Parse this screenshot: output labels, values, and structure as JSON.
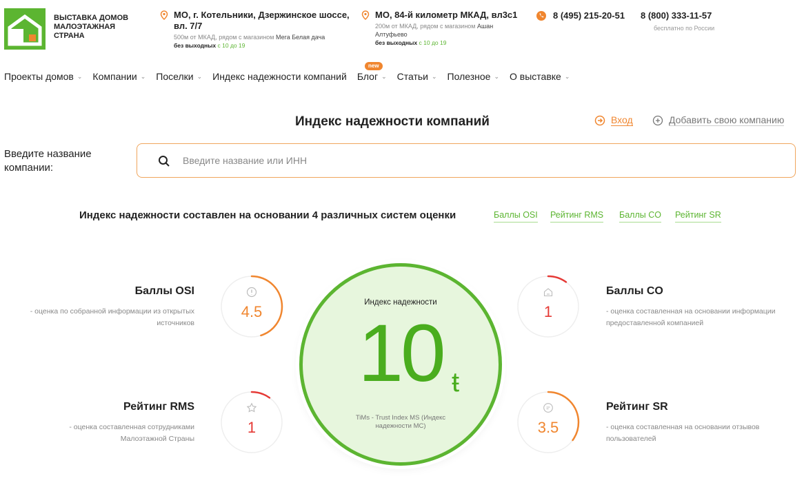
{
  "header": {
    "logo_text": "ВЫСТАВКА ДОМОВ МАЛОЭТАЖНАЯ СТРАНА",
    "locations": [
      {
        "address": "МО, г. Котельники, Дзержинское шоссе, вл. 7/7",
        "sub_prefix": "500м от МКАД, рядом с магазином",
        "sub_store": "Мега Белая дача",
        "hours_prefix": "без выходных",
        "hours": "с 10 до 19"
      },
      {
        "address": "МО, 84-й километр МКАД, вл3с1",
        "sub_prefix": "200м от МКАД, рядом с магазином",
        "sub_store": "Ашан Алтуфьево",
        "hours_prefix": "без выходных",
        "hours": "с 10 до 19"
      }
    ],
    "phone_main": "8 (495) 215-20-51",
    "phone_free": "8 (800) 333-11-57",
    "phone_free_note": "бесплатно по России"
  },
  "nav": {
    "items": [
      {
        "label": "Проекты домов",
        "dropdown": true
      },
      {
        "label": "Компании",
        "dropdown": true
      },
      {
        "label": "Поселки",
        "dropdown": true
      },
      {
        "label": "Индекс надежности компаний",
        "dropdown": false
      },
      {
        "label": "Блог",
        "dropdown": true
      },
      {
        "label": "Статьи",
        "dropdown": true
      },
      {
        "label": "Полезное",
        "dropdown": true
      },
      {
        "label": "О выставке",
        "dropdown": true
      }
    ],
    "badge": "new"
  },
  "page": {
    "title": "Индекс надежности компаний",
    "login": "Вход",
    "add_company": "Добавить свою компанию"
  },
  "search": {
    "label": "Введите название компании:",
    "placeholder": "Введите название или ИНН",
    "value": ""
  },
  "info": {
    "text": "Индекс надежности составлен на основании 4 различных систем оценки",
    "links": [
      "Баллы OSI",
      "Рейтинг RMS",
      "Баллы CO",
      "Рейтинг SR"
    ]
  },
  "index": {
    "label": "Индекс надежности",
    "value": "10",
    "unit": "ŧ",
    "description": "TiMs - Trust Index MS (Индекс надежности МС)"
  },
  "scores": {
    "osi": {
      "title": "Баллы OSI",
      "value": "4.5",
      "desc": "- оценка по собранной информации из открытых источников",
      "color": "#f0862f",
      "fraction": 0.45,
      "icon": "info-icon"
    },
    "rms": {
      "title": "Рейтинг RMS",
      "value": "1",
      "desc": "- оценка составленная сотрудниками Малоэтажной Страны",
      "color": "#e53935",
      "fraction": 0.1,
      "icon": "star-icon"
    },
    "co": {
      "title": "Баллы CO",
      "value": "1",
      "desc": "- оценка составленная на основании информации предоставленной компанией",
      "color": "#e53935",
      "fraction": 0.1,
      "icon": "house-icon"
    },
    "sr": {
      "title": "Рейтинг SR",
      "value": "3.5",
      "desc": "- оценка составленная на основании отзывов пользователей",
      "color": "#f0862f",
      "fraction": 0.35,
      "icon": "chat-icon"
    }
  },
  "colors": {
    "brand_green": "#5cb531",
    "accent_orange": "#f0862f",
    "low_red": "#e53935"
  }
}
